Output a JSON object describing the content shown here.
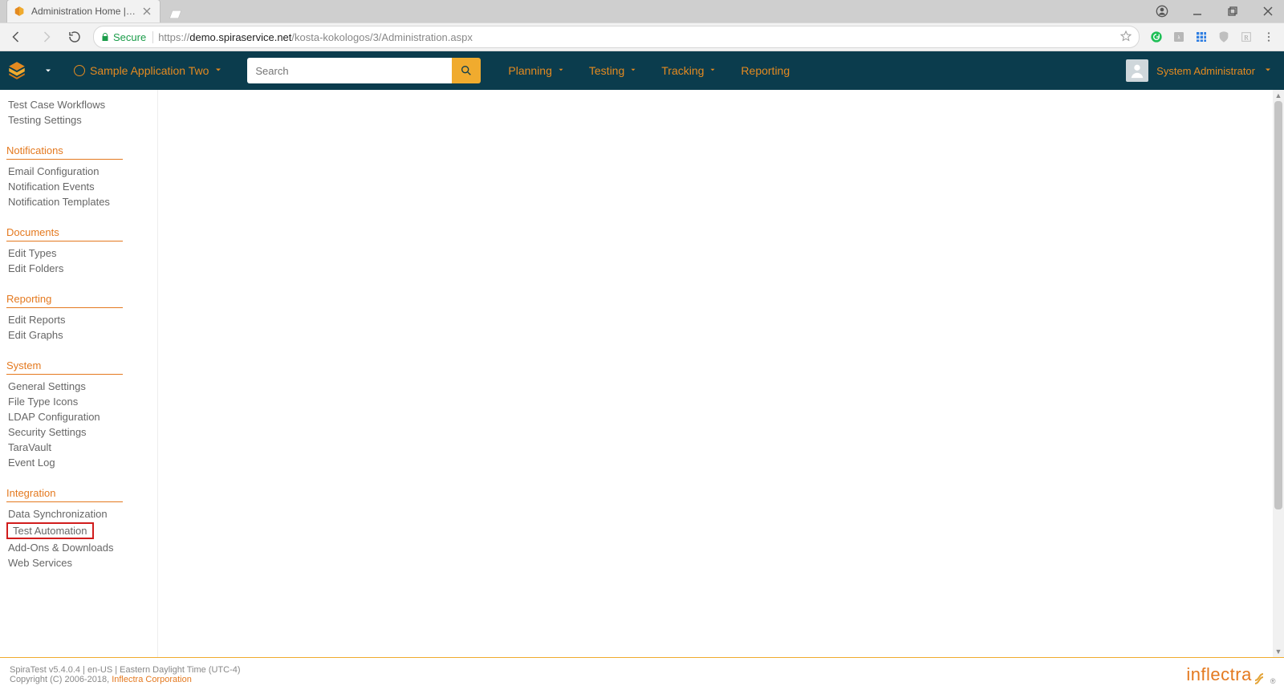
{
  "browser": {
    "tab_title": "Administration Home | Sp",
    "secure_label": "Secure",
    "url_prefix": "https://",
    "url_domain": "demo.spiraservice.net",
    "url_path": "/kosta-kokologos/3/Administration.aspx"
  },
  "topnav": {
    "project_label": "Sample Application Two",
    "search_placeholder": "Search",
    "menu": [
      "Planning",
      "Testing",
      "Tracking",
      "Reporting"
    ],
    "user_label": "System Administrator"
  },
  "sidebar": {
    "orphan_items": [
      "Test Case Workflows",
      "Testing Settings"
    ],
    "sections": [
      {
        "heading": "Notifications",
        "items": [
          "Email Configuration",
          "Notification Events",
          "Notification Templates"
        ]
      },
      {
        "heading": "Documents",
        "items": [
          "Edit Types",
          "Edit Folders"
        ]
      },
      {
        "heading": "Reporting",
        "items": [
          "Edit Reports",
          "Edit Graphs"
        ]
      },
      {
        "heading": "System",
        "items": [
          "General Settings",
          "File Type Icons",
          "LDAP Configuration",
          "Security Settings",
          "TaraVault",
          "Event Log"
        ]
      },
      {
        "heading": "Integration",
        "items": [
          "Data Synchronization",
          "Test Automation",
          "Add-Ons & Downloads",
          "Web Services"
        ],
        "highlight": "Test Automation"
      }
    ]
  },
  "footer": {
    "line1": "SpiraTest v5.4.0.4 | en-US | Eastern Daylight Time (UTC-4)",
    "copyright_prefix": "Copyright (C) 2006-2018, ",
    "company": "Inflectra Corporation",
    "logo_text": "inflectra"
  }
}
